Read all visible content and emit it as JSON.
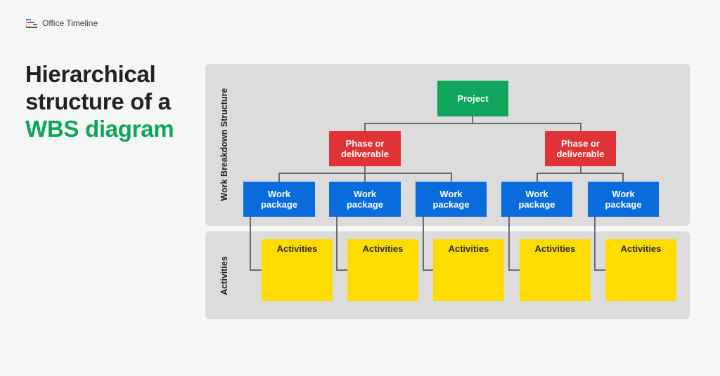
{
  "brand": {
    "name": "Office Timeline",
    "icon": "office-timeline-logo-icon"
  },
  "headline": {
    "line1": "Hierarchical",
    "line2": "structure of a",
    "accent": "WBS diagram"
  },
  "colors": {
    "project": "#0fa55a",
    "phase": "#e03337",
    "work_package": "#0a6cdc",
    "activities": "#ffdc00",
    "accent_text": "#0fa55a"
  },
  "diagram": {
    "wbs_panel_label": "Work Breakdown Structure",
    "activities_panel_label": "Activities",
    "project": {
      "label": "Project"
    },
    "phases": [
      {
        "label": "Phase or deliverable"
      },
      {
        "label": "Phase or deliverable"
      }
    ],
    "work_packages": [
      {
        "label": "Work package",
        "phase": 0
      },
      {
        "label": "Work package",
        "phase": 0
      },
      {
        "label": "Work package",
        "phase": 0
      },
      {
        "label": "Work package",
        "phase": 1
      },
      {
        "label": "Work package",
        "phase": 1
      }
    ],
    "activities": [
      {
        "label": "Activities"
      },
      {
        "label": "Activities"
      },
      {
        "label": "Activities"
      },
      {
        "label": "Activities"
      },
      {
        "label": "Activities"
      }
    ]
  }
}
